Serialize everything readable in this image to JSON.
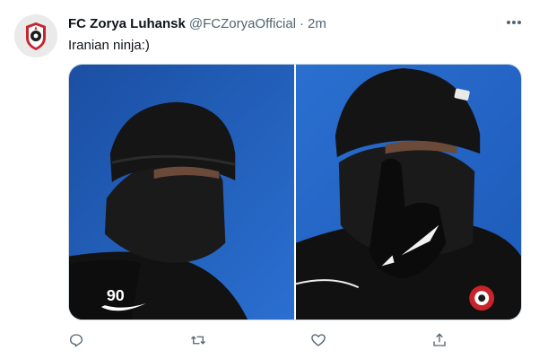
{
  "tweet": {
    "display_name": "FC Zorya Luhansk",
    "handle": "@FCZoryaOfficial",
    "separator": "·",
    "time": "2m",
    "text": "Iranian ninja:)"
  },
  "media": {
    "photos": [
      {
        "description_icon": "photo",
        "jersey_number": "90"
      },
      {
        "description_icon": "photo"
      }
    ]
  },
  "actions": [
    "reply-icon",
    "retweet-icon",
    "like-icon",
    "share-icon"
  ],
  "colors": {
    "text": "#0f1419",
    "secondary": "#536471",
    "sky": "#1a57b8",
    "border": "#cfd9de"
  }
}
